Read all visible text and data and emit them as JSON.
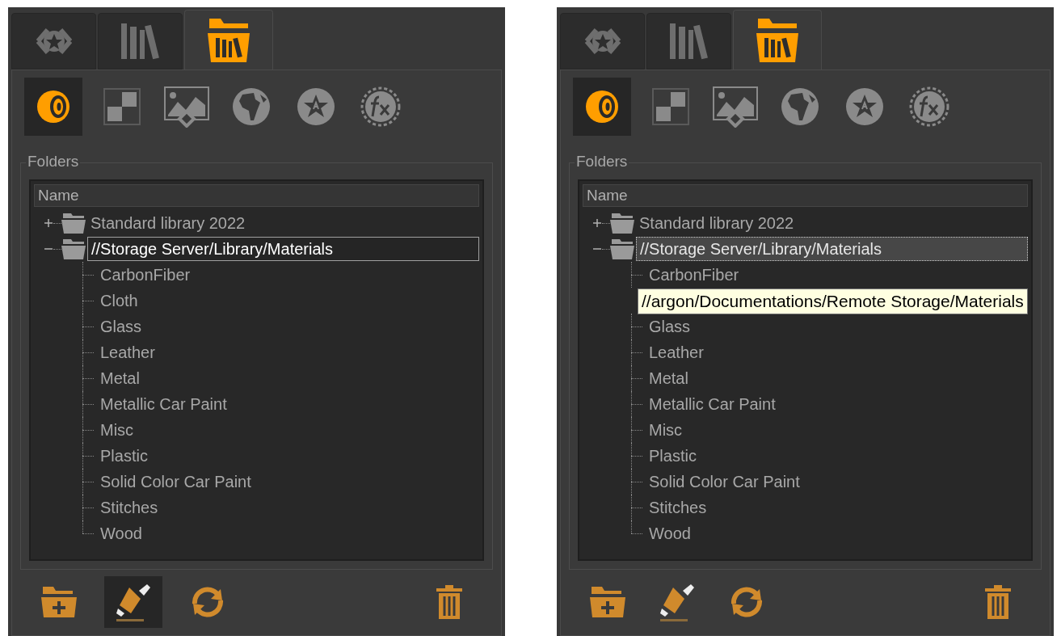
{
  "panels": [
    {
      "tabs": [
        {
          "selected": false
        },
        {
          "selected": false
        },
        {
          "selected": true
        }
      ],
      "subtabs": [
        {
          "kind": "material",
          "selected": true
        },
        {
          "kind": "texture",
          "selected": false
        },
        {
          "kind": "image",
          "selected": false
        },
        {
          "kind": "environment",
          "selected": false
        },
        {
          "kind": "decal",
          "selected": false
        },
        {
          "kind": "effect",
          "selected": false
        }
      ],
      "group_label": "Folders",
      "column_header": "Name",
      "tree": [
        {
          "label": "Standard library 2022",
          "expanded": false,
          "editing": false,
          "selected": false
        },
        {
          "label": "//Storage Server/Library/Materials",
          "expanded": true,
          "editing": true,
          "selected": false,
          "children": [
            {
              "kind": "folder",
              "label": "CarbonFiber"
            },
            {
              "kind": "folder",
              "label": "Cloth"
            },
            {
              "kind": "folder",
              "label": "Glass"
            },
            {
              "kind": "folder",
              "label": "Leather"
            },
            {
              "kind": "folder",
              "label": "Metal"
            },
            {
              "kind": "folder",
              "label": "Metallic Car Paint"
            },
            {
              "kind": "folder",
              "label": "Misc"
            },
            {
              "kind": "folder",
              "label": "Plastic"
            },
            {
              "kind": "folder",
              "label": "Solid Color Car Paint"
            },
            {
              "kind": "folder",
              "label": "Stitches"
            },
            {
              "kind": "folder",
              "label": "Wood"
            }
          ]
        }
      ],
      "toolbar": [
        {
          "kind": "new_folder",
          "hovered": false
        },
        {
          "kind": "rename",
          "hovered": true
        },
        {
          "kind": "refresh",
          "hovered": false
        },
        {
          "kind": "delete",
          "hovered": false
        }
      ]
    },
    {
      "tabs": [
        {
          "selected": false
        },
        {
          "selected": false
        },
        {
          "selected": true
        }
      ],
      "subtabs": [
        {
          "kind": "material",
          "selected": true
        },
        {
          "kind": "texture",
          "selected": false
        },
        {
          "kind": "image",
          "selected": false
        },
        {
          "kind": "environment",
          "selected": false
        },
        {
          "kind": "decal",
          "selected": false
        },
        {
          "kind": "effect",
          "selected": false
        }
      ],
      "group_label": "Folders",
      "column_header": "Name",
      "tree": [
        {
          "label": "Standard library 2022",
          "expanded": false,
          "editing": false,
          "selected": false
        },
        {
          "label": "//Storage Server/Library/Materials",
          "expanded": true,
          "editing": false,
          "selected": true,
          "children": [
            {
              "kind": "folder",
              "label": "CarbonFiber"
            },
            {
              "kind": "tooltip",
              "label": "//argon/Documentations/Remote Storage/Materials"
            },
            {
              "kind": "folder",
              "label": "Glass"
            },
            {
              "kind": "folder",
              "label": "Leather"
            },
            {
              "kind": "folder",
              "label": "Metal"
            },
            {
              "kind": "folder",
              "label": "Metallic Car Paint"
            },
            {
              "kind": "folder",
              "label": "Misc"
            },
            {
              "kind": "folder",
              "label": "Plastic"
            },
            {
              "kind": "folder",
              "label": "Solid Color Car Paint"
            },
            {
              "kind": "folder",
              "label": "Stitches"
            },
            {
              "kind": "folder",
              "label": "Wood"
            }
          ]
        }
      ],
      "toolbar": [
        {
          "kind": "new_folder",
          "hovered": false
        },
        {
          "kind": "rename",
          "hovered": false
        },
        {
          "kind": "refresh",
          "hovered": false
        },
        {
          "kind": "delete",
          "hovered": false
        }
      ]
    }
  ]
}
